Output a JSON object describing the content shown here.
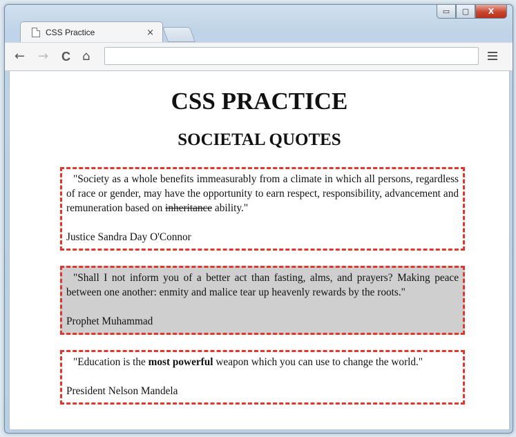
{
  "browser": {
    "tab_title": "CSS Practice",
    "tab_close": "×",
    "address_value": "",
    "nav": {
      "back": "←",
      "forward": "→",
      "reload": "C",
      "home": "⌂"
    },
    "window_controls": {
      "minimize": "▭",
      "maximize": "▢",
      "close": "X"
    }
  },
  "page": {
    "heading": "CSS PRACTICE",
    "subheading": "SOCIETAL QUOTES",
    "quotes": [
      {
        "text_before": "\"Society as a whole benefits immeasurably from a climate in which all persons, regardless of race or gender, may have the opportunity to earn respect, responsibility, advancement and remuneration based on ",
        "struck": "inheritance",
        "text_after": " ability.\"",
        "author": "Justice Sandra Day O'Connor"
      },
      {
        "text": "\"Shall I not inform you of a better act than fasting, alms, and prayers? Making peace between one another: enmity and malice tear up heavenly rewards by the roots.\"",
        "author": "Prophet Muhammad"
      },
      {
        "text_before": "\"Education is the ",
        "bold": "most powerful",
        "text_after": " weapon which you can use to change the world.\"",
        "author": "President Nelson Mandela"
      }
    ]
  },
  "colors": {
    "quote_border": "#e0362c",
    "shaded_background": "#cfcfcf"
  }
}
